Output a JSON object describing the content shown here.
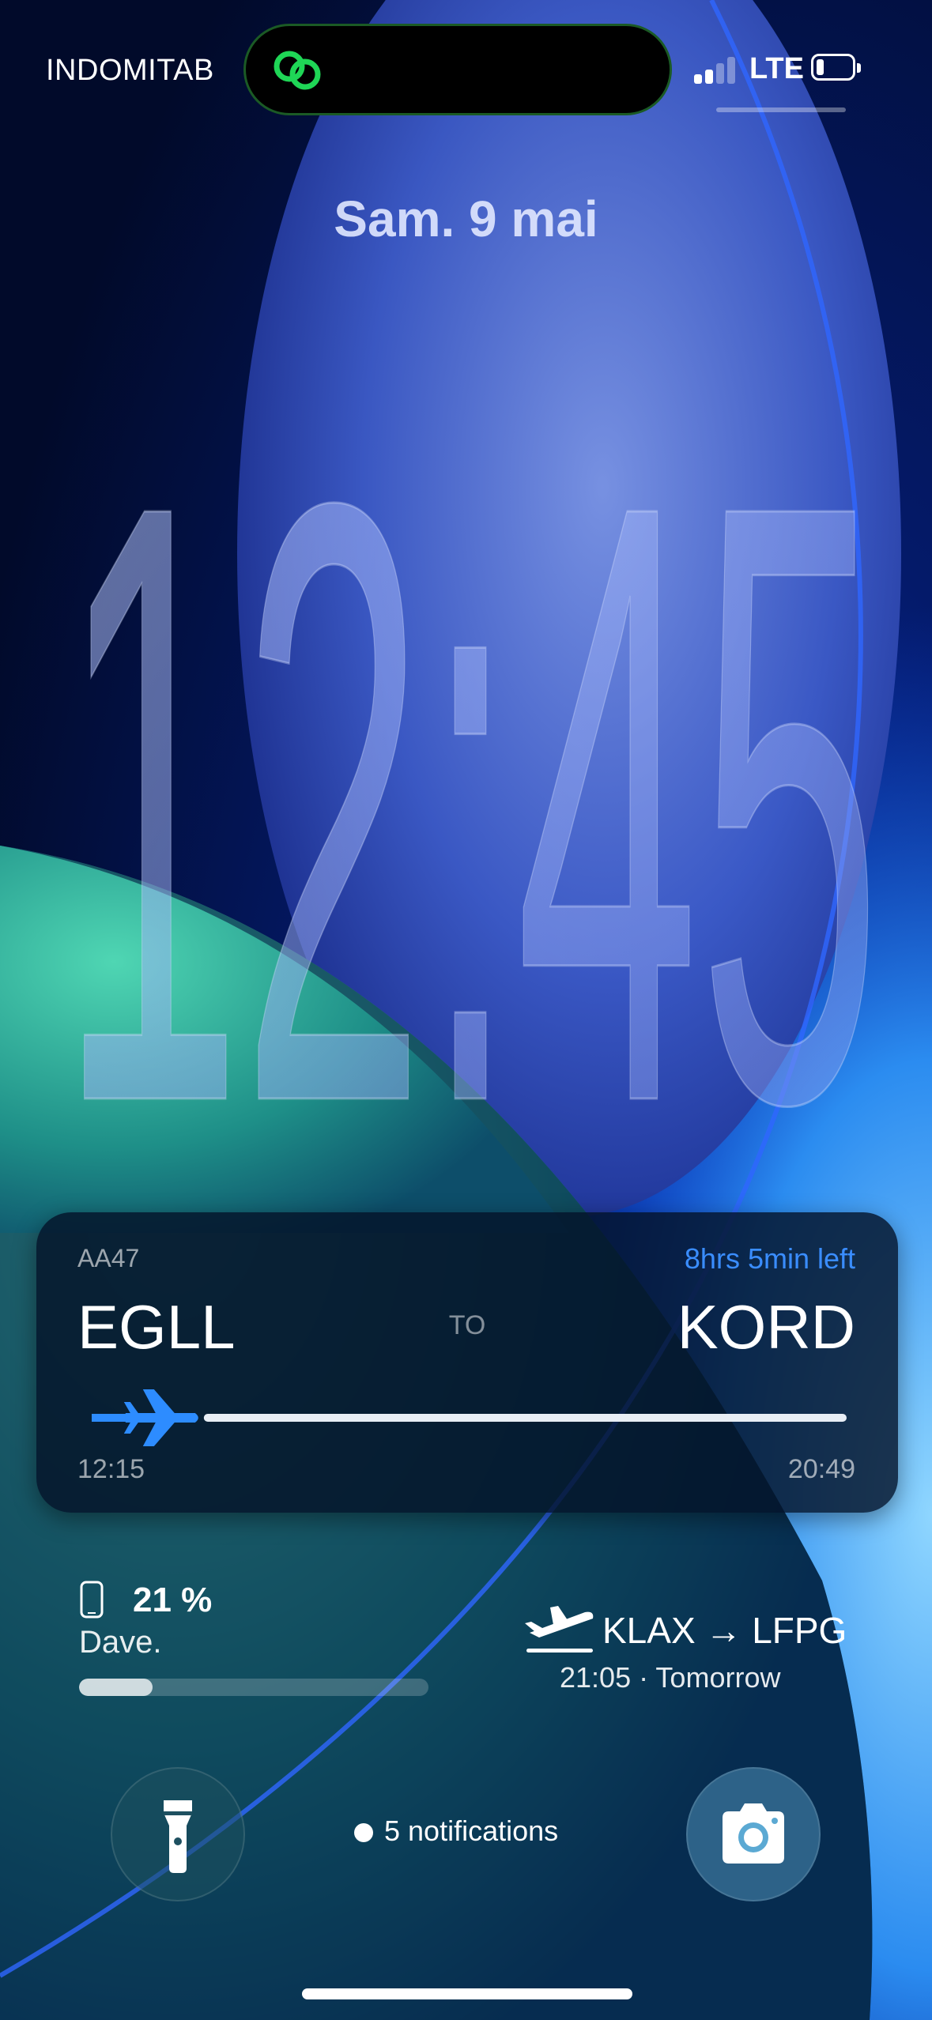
{
  "status_bar": {
    "carrier": "INDOMITAB",
    "network": "LTE",
    "battery_level": 0.15,
    "signal_bars_active": 2,
    "island_icon": "link-rings-icon",
    "island_color": "#1fd656"
  },
  "lock_screen": {
    "date": "Sam. 9 mai",
    "time": "12:45"
  },
  "flight_widget": {
    "flight_code": "AA47",
    "time_left": "8hrs 5min left",
    "origin": "EGLL",
    "to_label": "TO",
    "destination": "KORD",
    "departure_time": "12:15",
    "arrival_time": "20:49",
    "progress": 0.08,
    "accent": "#2d8cff",
    "plane_icon": "airplane-icon"
  },
  "battery_widget": {
    "percent": "21 %",
    "device": "Dave.",
    "level": 0.21,
    "icon": "phone-icon"
  },
  "next_flight_widget": {
    "route": "KLAX → LFPG",
    "time": "21:05 · Tomorrow",
    "icon": "airplane-takeoff-icon"
  },
  "controls": {
    "flashlight_icon": "flashlight-icon",
    "camera_icon": "camera-icon",
    "notifications": "5 notifications"
  }
}
